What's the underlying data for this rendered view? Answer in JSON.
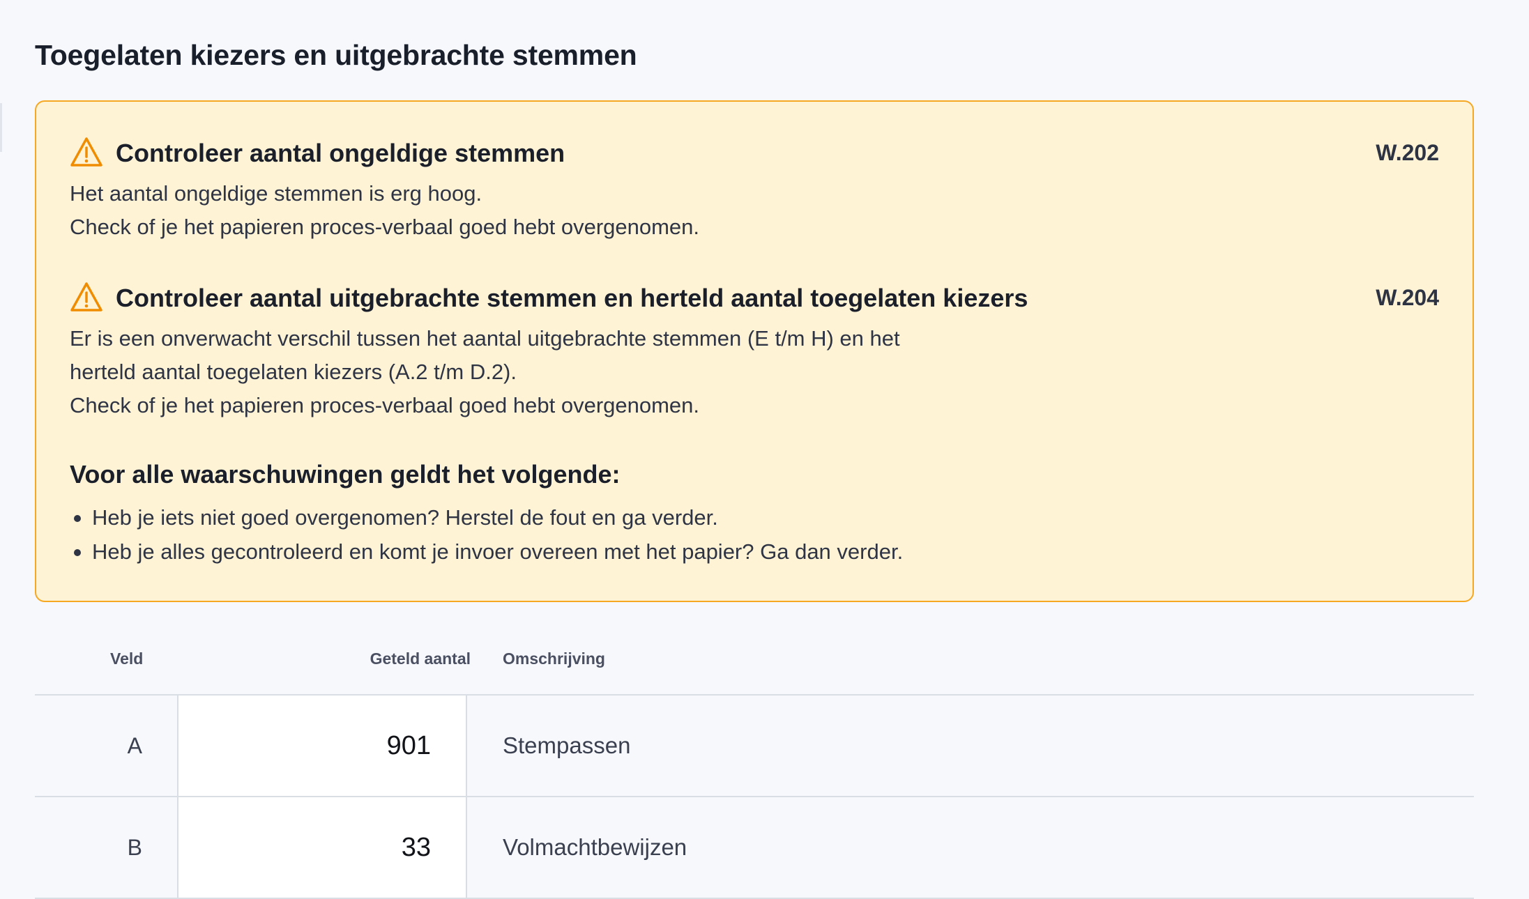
{
  "page": {
    "title": "Toegelaten kiezers en uitgebrachte stemmen"
  },
  "warnings": [
    {
      "title": "Controleer aantal ongeldige stemmen",
      "code": "W.202",
      "lines": [
        "Het aantal ongeldige stemmen is erg hoog.",
        "Check of je het papieren proces-verbaal goed hebt overgenomen."
      ]
    },
    {
      "title": "Controleer aantal uitgebrachte stemmen en herteld aantal toegelaten kiezers",
      "code": "W.204",
      "lines": [
        "Er is een onverwacht verschil tussen het aantal uitgebrachte stemmen (E t/m H) en het",
        "herteld aantal toegelaten kiezers (A.2 t/m D.2).",
        "Check of je het papieren proces-verbaal goed hebt overgenomen."
      ]
    }
  ],
  "general": {
    "title": "Voor alle waarschuwingen geldt het volgende:",
    "items": [
      "Heb je iets niet goed overgenomen? Herstel de fout en ga verder.",
      "Heb je alles gecontroleerd en komt je invoer overeen met het papier? Ga dan verder."
    ]
  },
  "table": {
    "headers": {
      "field": "Veld",
      "count": "Geteld aantal",
      "description": "Omschrijving"
    },
    "rows": [
      {
        "field": "A",
        "value": "901",
        "description": "Stempassen"
      },
      {
        "field": "B",
        "value": "33",
        "description": "Volmachtbewijzen"
      }
    ]
  },
  "colors": {
    "warning_background": "#fff3d6",
    "warning_border": "#f7a823",
    "warning_icon": "#f08c00"
  },
  "icons": {
    "warning": "warning-triangle-icon"
  }
}
